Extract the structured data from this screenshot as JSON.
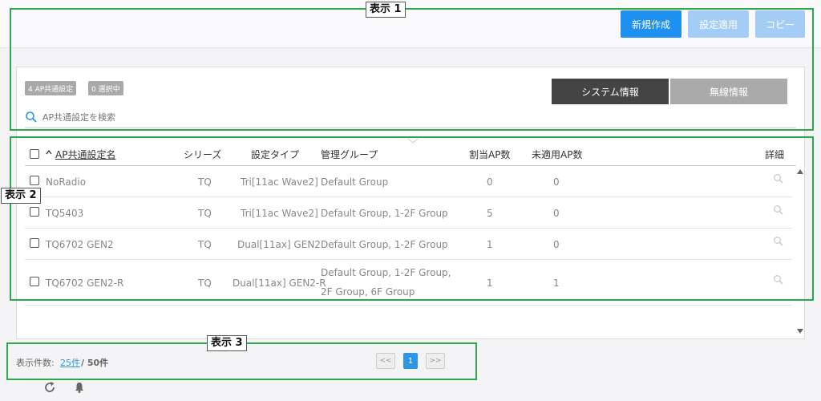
{
  "toolbar": {
    "new_label": "新規作成",
    "apply_label": "設定適用",
    "copy_label": "コピー"
  },
  "filters": {
    "count_badge": "4 AP共通設定",
    "selected_badge": "0 選択中"
  },
  "tabs": [
    {
      "label": "システム情報",
      "active": true
    },
    {
      "label": "無線情報",
      "active": false
    }
  ],
  "search": {
    "placeholder": "AP共通設定を検索"
  },
  "table": {
    "columns": {
      "name": "AP共通設定名",
      "series": "シリーズ",
      "type": "設定タイプ",
      "group": "管理グループ",
      "assigned": "割当AP数",
      "unapplied": "未適用AP数",
      "detail": "詳細"
    },
    "rows": [
      {
        "name": "NoRadio",
        "series": "TQ",
        "type": "Tri[11ac Wave2]",
        "group": "Default Group",
        "assigned": "0",
        "unapplied": "0"
      },
      {
        "name": "TQ5403",
        "series": "TQ",
        "type": "Tri[11ac Wave2]",
        "group": "Default Group, 1-2F Group",
        "assigned": "5",
        "unapplied": "0"
      },
      {
        "name": "TQ6702 GEN2",
        "series": "TQ",
        "type": "Dual[11ax] GEN2",
        "group": "Default Group, 1-2F Group",
        "assigned": "1",
        "unapplied": "0"
      },
      {
        "name": "TQ6702 GEN2-R",
        "series": "TQ",
        "type": "Dual[11ax] GEN2-R",
        "group": "Default Group, 1-2F Group, 2F Group, 6F Group",
        "assigned": "1",
        "unapplied": "1"
      }
    ]
  },
  "footer": {
    "count_label": "表示件数:",
    "per_page": "25件",
    "total": "/ 50件",
    "prev": "<<",
    "current_page": "1",
    "next": ">>"
  },
  "annotations": {
    "label1": "表示 1",
    "label2": "表示 2",
    "label3": "表示 3"
  },
  "colors": {
    "primary": "#1e90f0",
    "disabled": "#a3cdf5",
    "frame": "#2da84a"
  }
}
